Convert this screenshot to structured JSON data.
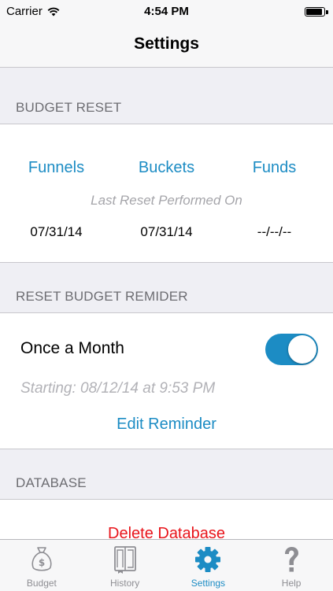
{
  "status_bar": {
    "carrier": "Carrier",
    "time": "4:54 PM",
    "battery_level": 0.95
  },
  "nav": {
    "title": "Settings"
  },
  "budget_reset": {
    "header": "BUDGET RESET",
    "columns": [
      {
        "label": "Funnels",
        "date": "07/31/14"
      },
      {
        "label": "Buckets",
        "date": "07/31/14"
      },
      {
        "label": "Funds",
        "date": "--/--/--"
      }
    ],
    "caption": "Last Reset Performed On"
  },
  "reminder": {
    "header": "RESET BUDGET REMIDER",
    "frequency": "Once a Month",
    "enabled": true,
    "starting": "Starting: 08/12/14 at 9:53 PM",
    "edit_label": "Edit Reminder"
  },
  "database": {
    "header": "DATABASE",
    "delete_label": "Delete Database"
  },
  "tabs": [
    {
      "label": "Budget",
      "icon": "money-bag-icon",
      "active": false
    },
    {
      "label": "History",
      "icon": "book-icon",
      "active": false
    },
    {
      "label": "Settings",
      "icon": "gear-icon",
      "active": true
    },
    {
      "label": "Help",
      "icon": "question-mark-icon",
      "active": false
    }
  ],
  "colors": {
    "accent": "#1c8cc4",
    "destructive": "#e8141b",
    "section_bg": "#efeff4"
  }
}
